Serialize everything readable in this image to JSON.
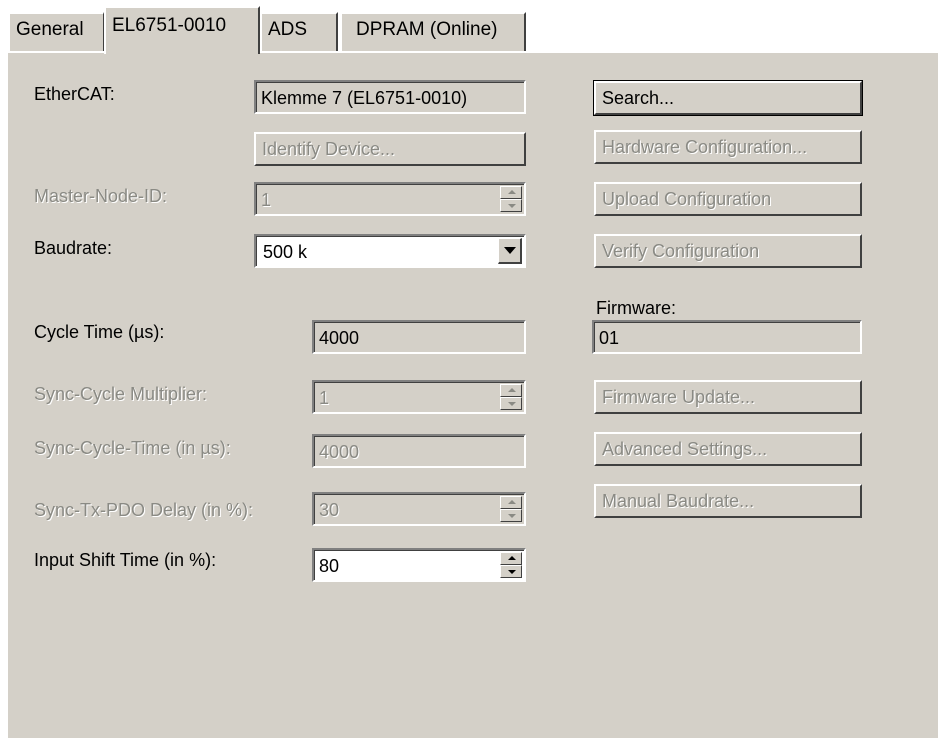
{
  "tabs": [
    {
      "label": "General"
    },
    {
      "label": "EL6751-0010"
    },
    {
      "label": "ADS"
    },
    {
      "label": "DPRAM (Online)"
    }
  ],
  "left": {
    "ethercat_label": "EtherCAT:",
    "ethercat_value": "Klemme 7 (EL6751-0010)",
    "identify_button": "Identify Device...",
    "master_node_label": "Master-Node-ID:",
    "master_node_value": "1",
    "baudrate_label": "Baudrate:",
    "baudrate_value": "500 k",
    "cycle_time_label": "Cycle Time (µs):",
    "cycle_time_value": "4000",
    "sync_mult_label": "Sync-Cycle Multiplier:",
    "sync_mult_value": "1",
    "sync_time_label": "Sync-Cycle-Time (in µs):",
    "sync_time_value": "4000",
    "sync_tx_label": "Sync-Tx-PDO Delay (in %):",
    "sync_tx_value": "30",
    "input_shift_label": "Input Shift Time (in %):",
    "input_shift_value": "80"
  },
  "right": {
    "search_button": "Search...",
    "hw_config_button": "Hardware Configuration...",
    "upload_button": "Upload Configuration",
    "verify_button": "Verify Configuration",
    "firmware_label": "Firmware:",
    "firmware_value": "01",
    "fw_update_button": "Firmware Update...",
    "advanced_button": "Advanced Settings...",
    "manual_baud_button": "Manual Baudrate..."
  },
  "colors": {
    "face": "#d4d0c8",
    "disabled_text": "#8a8a84"
  }
}
